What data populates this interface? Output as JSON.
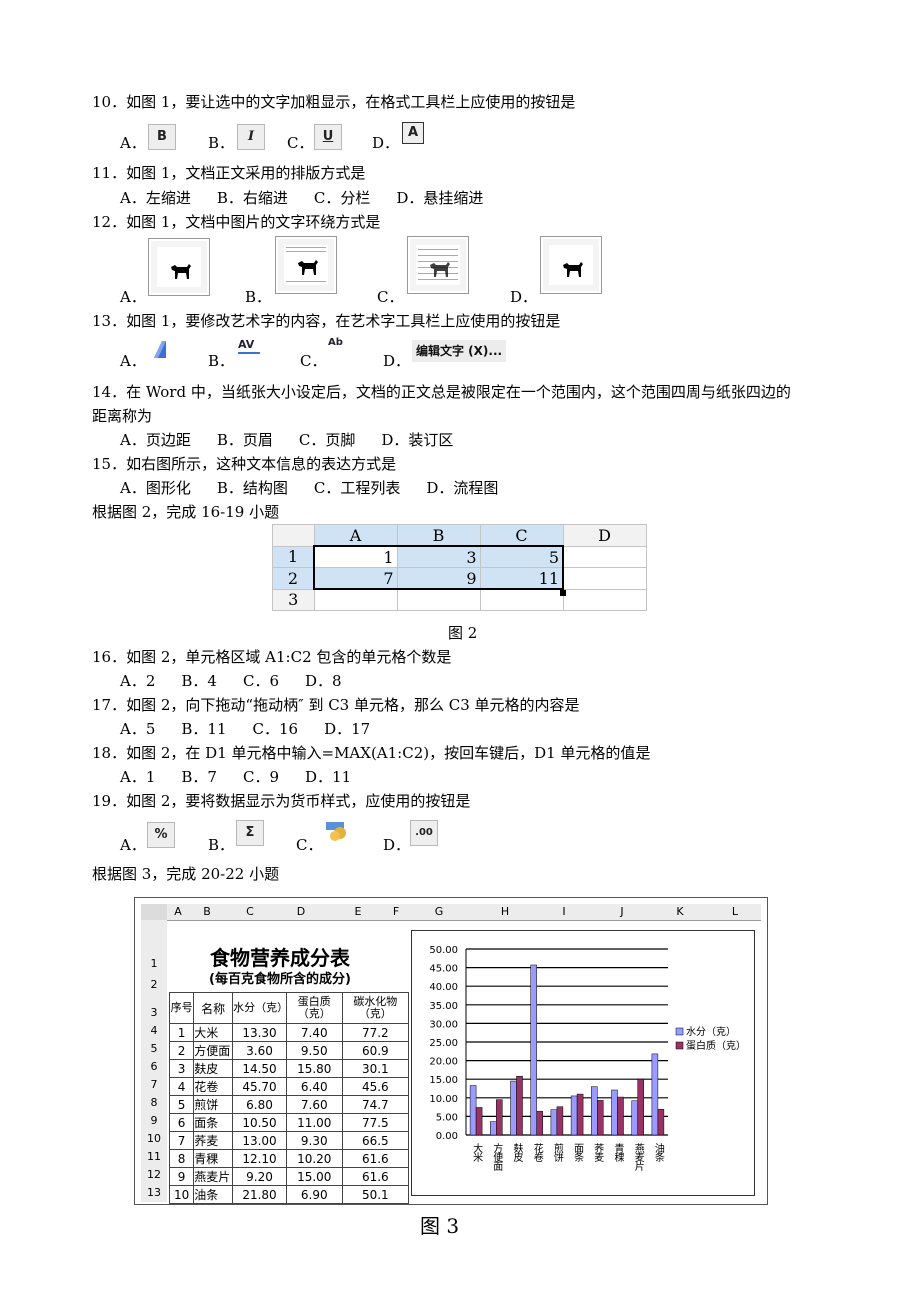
{
  "q10": {
    "text": "10．如图 1，要让选中的文字加粗显示，在格式工具栏上应使用的按钮是",
    "a": "A．",
    "b": "B．",
    "c": "C．",
    "d": "D．",
    "icon_a": "B",
    "icon_b": "I",
    "icon_c": "U",
    "icon_d": "A",
    "icons": [
      "bold-icon",
      "italic-icon",
      "underline-icon",
      "char-border-icon"
    ]
  },
  "q11": {
    "text": "11．如图 1，文档正文采用的排版方式是",
    "opts": [
      "A．左缩进",
      "B．右缩进",
      "C．分栏",
      "D．悬挂缩进"
    ]
  },
  "q12": {
    "text": "12．如图 1，文档中图片的文字环绕方式是",
    "a": "A．",
    "b": "B．",
    "c": "C．",
    "d": "D．",
    "icons": [
      "wrap-square-icon",
      "wrap-top-bottom-icon",
      "wrap-behind-text-icon",
      "wrap-tight-icon"
    ]
  },
  "q13": {
    "text": "13．如图 1，要修改艺术字的内容，在艺术字工具栏上应使用的按钮是",
    "a": "A．",
    "b": "B．",
    "c": "C．",
    "d": "D．",
    "icon_b": "AV",
    "icon_c": "Ab",
    "icon_d": "编辑文字 (X)...",
    "icons": [
      "wordart-shape-icon",
      "wordart-spacing-icon",
      "wordart-vertical-icon",
      "edit-text-button"
    ]
  },
  "q14": {
    "line1": "14．在 Word 中，当纸张大小设定后，文档的正文总是被限定在一个范围内，这个范围四周与纸张四边的",
    "line2": "距离称为",
    "opts": [
      "A．页边距",
      "B．页眉",
      "C．页脚",
      "D．装订区"
    ]
  },
  "q15": {
    "text": "15．如右图所示，这种文本信息的表达方式是",
    "opts": [
      "A．图形化",
      "B．结构图",
      "C．工程列表",
      "D．流程图"
    ]
  },
  "fig2_intro": "根据图 2，完成 16-19 小题",
  "fig2": {
    "cols": [
      "A",
      "B",
      "C",
      "D"
    ],
    "rows": [
      {
        "n": "1",
        "vals": [
          "1",
          "3",
          "5",
          ""
        ]
      },
      {
        "n": "2",
        "vals": [
          "7",
          "9",
          "11",
          ""
        ]
      },
      {
        "n": "3",
        "vals": [
          "",
          "",
          "",
          ""
        ]
      }
    ],
    "caption": "图 2"
  },
  "q16": {
    "text": "16．如图 2，单元格区域 A1:C2 包含的单元格个数是",
    "opts": [
      "A．2",
      "B．4",
      "C．6",
      "D．8"
    ]
  },
  "q17": {
    "text": "17．如图 2，向下拖动“拖动柄″ 到 C3 单元格，那么 C3 单元格的内容是",
    "opts": [
      "A．5",
      "B．11",
      "C．16",
      "D．17"
    ]
  },
  "q18": {
    "text": "18．如图 2，在 D1 单元格中输入=MAX(A1:C2)，按回车键后，D1 单元格的值是",
    "opts": [
      "A．1",
      "B．7",
      "C．9",
      "D．11"
    ]
  },
  "q19": {
    "text": "19．如图 2，要将数据显示为货币样式，应使用的按钮是",
    "a": "A．",
    "b": "B．",
    "c": "C．",
    "d": "D．",
    "icon_a": "%",
    "icon_b": "Σ",
    "icon_d": ".00",
    "icons": [
      "percent-icon",
      "sum-icon",
      "currency-icon",
      "increase-decimal-icon"
    ]
  },
  "fig3_intro": "根据图 3，完成 20-22 小题",
  "fig3": {
    "col_headers": [
      "A",
      "B",
      "C",
      "D",
      "E",
      "F",
      "G",
      "H",
      "I",
      "J",
      "K",
      "L"
    ],
    "row_headers": [
      "1",
      "2",
      "3",
      "4",
      "5",
      "6",
      "7",
      "8",
      "9",
      "10",
      "11",
      "12",
      "13"
    ],
    "title": "食物营养成分表",
    "subtitle": "(每百克食物所含的成分)",
    "headers": [
      "序号",
      "名称",
      "水分（克）",
      "蛋白质（克）",
      "碳水化物（克）"
    ],
    "rows": [
      [
        "1",
        "大米",
        "13.30",
        "7.40",
        "77.2"
      ],
      [
        "2",
        "方便面",
        "3.60",
        "9.50",
        "60.9"
      ],
      [
        "3",
        "麸皮",
        "14.50",
        "15.80",
        "30.1"
      ],
      [
        "4",
        "花卷",
        "45.70",
        "6.40",
        "45.6"
      ],
      [
        "5",
        "煎饼",
        "6.80",
        "7.60",
        "74.7"
      ],
      [
        "6",
        "面条",
        "10.50",
        "11.00",
        "77.5"
      ],
      [
        "7",
        "荞麦",
        "13.00",
        "9.30",
        "66.5"
      ],
      [
        "8",
        "青稞",
        "12.10",
        "10.20",
        "61.6"
      ],
      [
        "9",
        "燕麦片",
        "9.20",
        "15.00",
        "61.6"
      ],
      [
        "10",
        "油条",
        "21.80",
        "6.90",
        "50.1"
      ]
    ],
    "caption": "图 3"
  },
  "chart_data": {
    "type": "bar",
    "categories": [
      "大米",
      "方便面",
      "麸皮",
      "花卷",
      "煎饼",
      "面条",
      "荞麦",
      "青稞",
      "燕麦片",
      "油条"
    ],
    "series": [
      {
        "name": "水分（克）",
        "values": [
          13.3,
          3.6,
          14.5,
          45.7,
          6.8,
          10.5,
          13.0,
          12.1,
          9.2,
          21.8
        ],
        "color": "#9b9bff"
      },
      {
        "name": "蛋白质（克）",
        "values": [
          7.4,
          9.5,
          15.8,
          6.4,
          7.6,
          11.0,
          9.3,
          10.2,
          15.0,
          6.9
        ],
        "color": "#993366"
      }
    ],
    "yticks": [
      "50.00",
      "45.00",
      "40.00",
      "35.00",
      "30.00",
      "25.00",
      "20.00",
      "15.00",
      "10.00",
      "5.00",
      "0.00"
    ],
    "ylim": [
      0,
      50
    ],
    "legend": "right"
  }
}
